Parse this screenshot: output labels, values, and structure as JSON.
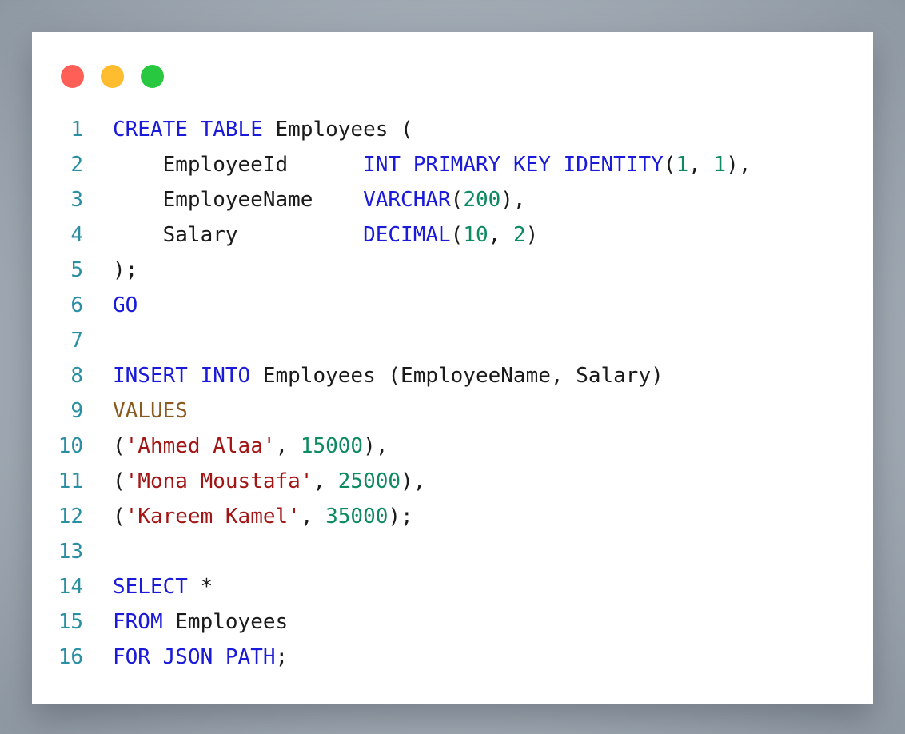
{
  "window": {
    "controls": [
      "close",
      "minimize",
      "maximize"
    ]
  },
  "colors": {
    "keyword": "#1a1ad8",
    "function_keyword": "#8a5a1e",
    "number": "#0d8a5e",
    "string": "#a31515",
    "text": "#1a1a1a",
    "line_number": "#2b8fa3",
    "close": "#ff5f57",
    "minimize": "#febc2e",
    "maximize": "#28c840"
  },
  "code": {
    "lines": [
      {
        "n": "1",
        "tokens": [
          {
            "t": "CREATE",
            "c": "kw"
          },
          {
            "t": " ",
            "c": "txt"
          },
          {
            "t": "TABLE",
            "c": "kw"
          },
          {
            "t": " Employees (",
            "c": "txt"
          }
        ]
      },
      {
        "n": "2",
        "tokens": [
          {
            "t": "    EmployeeId      ",
            "c": "txt"
          },
          {
            "t": "INT",
            "c": "kw"
          },
          {
            "t": " ",
            "c": "txt"
          },
          {
            "t": "PRIMARY",
            "c": "kw"
          },
          {
            "t": " ",
            "c": "txt"
          },
          {
            "t": "KEY",
            "c": "kw"
          },
          {
            "t": " ",
            "c": "txt"
          },
          {
            "t": "IDENTITY",
            "c": "kw"
          },
          {
            "t": "(",
            "c": "txt"
          },
          {
            "t": "1",
            "c": "num"
          },
          {
            "t": ", ",
            "c": "txt"
          },
          {
            "t": "1",
            "c": "num"
          },
          {
            "t": "),",
            "c": "txt"
          }
        ]
      },
      {
        "n": "3",
        "tokens": [
          {
            "t": "    EmployeeName    ",
            "c": "txt"
          },
          {
            "t": "VARCHAR",
            "c": "kw"
          },
          {
            "t": "(",
            "c": "txt"
          },
          {
            "t": "200",
            "c": "num"
          },
          {
            "t": "),",
            "c": "txt"
          }
        ]
      },
      {
        "n": "4",
        "tokens": [
          {
            "t": "    Salary          ",
            "c": "txt"
          },
          {
            "t": "DECIMAL",
            "c": "kw"
          },
          {
            "t": "(",
            "c": "txt"
          },
          {
            "t": "10",
            "c": "num"
          },
          {
            "t": ", ",
            "c": "txt"
          },
          {
            "t": "2",
            "c": "num"
          },
          {
            "t": ")",
            "c": "txt"
          }
        ]
      },
      {
        "n": "5",
        "tokens": [
          {
            "t": ");",
            "c": "txt"
          }
        ]
      },
      {
        "n": "6",
        "tokens": [
          {
            "t": "GO",
            "c": "kw"
          }
        ]
      },
      {
        "n": "7",
        "tokens": []
      },
      {
        "n": "8",
        "tokens": [
          {
            "t": "INSERT",
            "c": "kw"
          },
          {
            "t": " ",
            "c": "txt"
          },
          {
            "t": "INTO",
            "c": "kw"
          },
          {
            "t": " Employees (EmployeeName, Salary)",
            "c": "txt"
          }
        ]
      },
      {
        "n": "9",
        "tokens": [
          {
            "t": "VALUES",
            "c": "fn"
          }
        ]
      },
      {
        "n": "10",
        "tokens": [
          {
            "t": "(",
            "c": "txt"
          },
          {
            "t": "'Ahmed Alaa'",
            "c": "str"
          },
          {
            "t": ", ",
            "c": "txt"
          },
          {
            "t": "15000",
            "c": "num"
          },
          {
            "t": "),",
            "c": "txt"
          }
        ]
      },
      {
        "n": "11",
        "tokens": [
          {
            "t": "(",
            "c": "txt"
          },
          {
            "t": "'Mona Moustafa'",
            "c": "str"
          },
          {
            "t": ", ",
            "c": "txt"
          },
          {
            "t": "25000",
            "c": "num"
          },
          {
            "t": "),",
            "c": "txt"
          }
        ]
      },
      {
        "n": "12",
        "tokens": [
          {
            "t": "(",
            "c": "txt"
          },
          {
            "t": "'Kareem Kamel'",
            "c": "str"
          },
          {
            "t": ", ",
            "c": "txt"
          },
          {
            "t": "35000",
            "c": "num"
          },
          {
            "t": ");",
            "c": "txt"
          }
        ]
      },
      {
        "n": "13",
        "tokens": []
      },
      {
        "n": "14",
        "tokens": [
          {
            "t": "SELECT",
            "c": "kw"
          },
          {
            "t": " *",
            "c": "txt"
          }
        ]
      },
      {
        "n": "15",
        "tokens": [
          {
            "t": "FROM",
            "c": "kw"
          },
          {
            "t": " Employees",
            "c": "txt"
          }
        ]
      },
      {
        "n": "16",
        "tokens": [
          {
            "t": "FOR",
            "c": "kw"
          },
          {
            "t": " ",
            "c": "txt"
          },
          {
            "t": "JSON",
            "c": "kw"
          },
          {
            "t": " ",
            "c": "txt"
          },
          {
            "t": "PATH",
            "c": "kw"
          },
          {
            "t": ";",
            "c": "txt"
          }
        ]
      }
    ]
  }
}
